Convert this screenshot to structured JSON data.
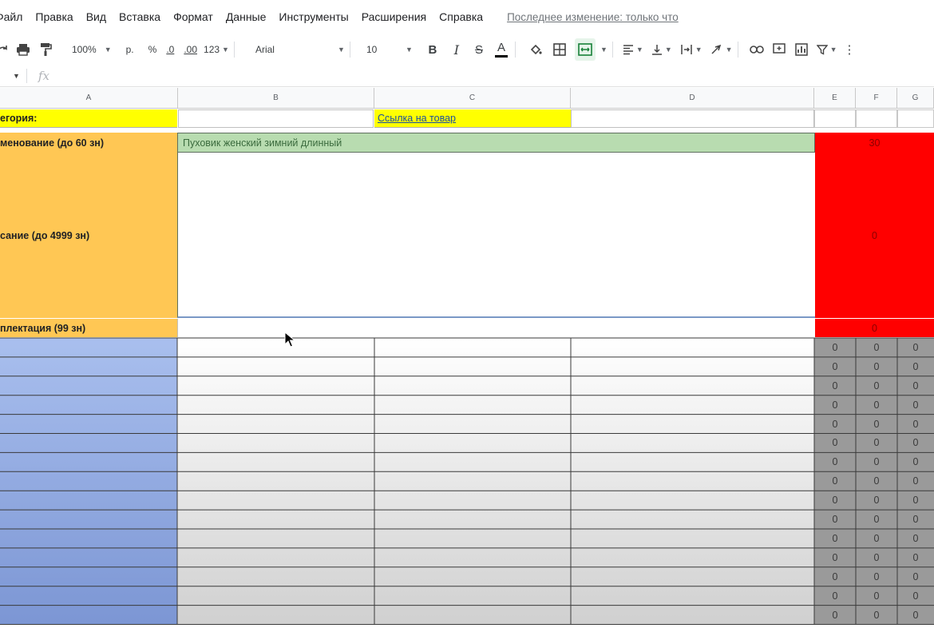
{
  "menubar": {
    "items": [
      "Файл",
      "Правка",
      "Вид",
      "Вставка",
      "Формат",
      "Данные",
      "Инструменты",
      "Расширения",
      "Справка"
    ],
    "last_edit": "Последнее изменение: только что"
  },
  "toolbar": {
    "zoom": "100%",
    "currency": "р.",
    "percent": "%",
    "dec_less": ".0",
    "dec_more": ".00",
    "format_more": "123",
    "font": "Arial",
    "font_size": "10"
  },
  "formula_bar": {
    "fx": "fx"
  },
  "grid": {
    "columns": [
      "A",
      "B",
      "C",
      "D",
      "E",
      "F",
      "G"
    ],
    "row1": {
      "a": "егория:",
      "c": "Ссылка на товар"
    },
    "row2": {
      "a": "менование (до 60 зн)",
      "b": "Пуховик женский зимний длинный",
      "count": "30"
    },
    "row3": {
      "a": "сание (до 4999 зн)",
      "count": "0"
    },
    "row4": {
      "a": "плектация (99 зн)",
      "count": "0"
    },
    "zero_rows": [
      [
        "0",
        "0",
        "0"
      ],
      [
        "0",
        "0",
        "0"
      ],
      [
        "0",
        "0",
        "0"
      ],
      [
        "0",
        "0",
        "0"
      ],
      [
        "0",
        "0",
        "0"
      ],
      [
        "0",
        "0",
        "0"
      ],
      [
        "0",
        "0",
        "0"
      ],
      [
        "0",
        "0",
        "0"
      ],
      [
        "0",
        "0",
        "0"
      ],
      [
        "0",
        "0",
        "0"
      ],
      [
        "0",
        "0",
        "0"
      ],
      [
        "0",
        "0",
        "0"
      ],
      [
        "0",
        "0",
        "0"
      ],
      [
        "0",
        "0",
        "0"
      ],
      [
        "0",
        "0",
        "0"
      ]
    ]
  },
  "colors": {
    "yellow": "#ffff00",
    "orange": "#ffc754",
    "green": "#b8dcb0",
    "red": "#ff0000",
    "blue": "#8fa9e6",
    "gray_counter": "#9a9a9a"
  }
}
